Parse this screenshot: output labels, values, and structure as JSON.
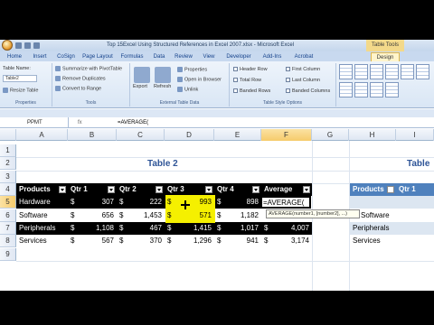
{
  "window": {
    "title": "Top 15Excel Using Structured References in Excel 2007.xlsx - Microsoft Excel",
    "context_tab": "Table Tools"
  },
  "ribbon_tabs": [
    "Home",
    "Insert",
    "CoSign",
    "Page Layout",
    "Formulas",
    "Data",
    "Review",
    "View",
    "Developer",
    "Add-Ins",
    "Acrobat",
    "Design"
  ],
  "ribbon": {
    "properties": {
      "label": "Properties",
      "table_name_label": "Table Name:",
      "table_name_value": "Table2",
      "resize": "Resize Table"
    },
    "tools": {
      "label": "Tools",
      "pivot": "Summarize with PivotTable",
      "dupes": "Remove Duplicates",
      "convert": "Convert to Range"
    },
    "external": {
      "label": "External Table Data",
      "export": "Export",
      "refresh": "Refresh",
      "props": "Properties",
      "browser": "Open in Browser",
      "unlink": "Unlink"
    },
    "style_options": {
      "label": "Table Style Options",
      "header_row": "Header Row",
      "total_row": "Total Row",
      "banded_rows": "Banded Rows",
      "first_column": "First Column",
      "last_column": "Last Column",
      "banded_columns": "Banded Columns"
    }
  },
  "formula_bar": {
    "name_box": "PPMT",
    "fx": "fx",
    "formula": "=AVERAGE("
  },
  "columns": [
    "A",
    "B",
    "C",
    "D",
    "E",
    "F",
    "G",
    "H",
    "I"
  ],
  "rows": [
    "1",
    "2",
    "3",
    "4",
    "5",
    "6",
    "7",
    "8",
    "9"
  ],
  "table2": {
    "title": "Table 2",
    "headers": [
      "Products",
      "Qtr 1",
      "Qtr 2",
      "Qtr 3",
      "Qtr 4",
      "Average"
    ],
    "rows": [
      {
        "product": "Hardware",
        "q1": "307",
        "q2": "222",
        "q3": "993",
        "q4": "898",
        "avg": "=AVERAGE("
      },
      {
        "product": "Software",
        "q1": "656",
        "q2": "1,453",
        "q3": "571",
        "q4": "1,182",
        "avg": ""
      },
      {
        "product": "Peripherals",
        "q1": "1,108",
        "q2": "467",
        "q3": "1,415",
        "q4": "1,017",
        "avg": "4,007"
      },
      {
        "product": "Services",
        "q1": "567",
        "q2": "370",
        "q3": "1,296",
        "q4": "941",
        "avg": "3,174"
      }
    ],
    "currency": "$"
  },
  "tooltip": "AVERAGE(number1, [number2], ...)",
  "right_table": {
    "title": "Table",
    "headers": [
      "Products",
      "Qtr 1"
    ],
    "rows": [
      "Software",
      "Peripherals",
      "Services"
    ]
  }
}
